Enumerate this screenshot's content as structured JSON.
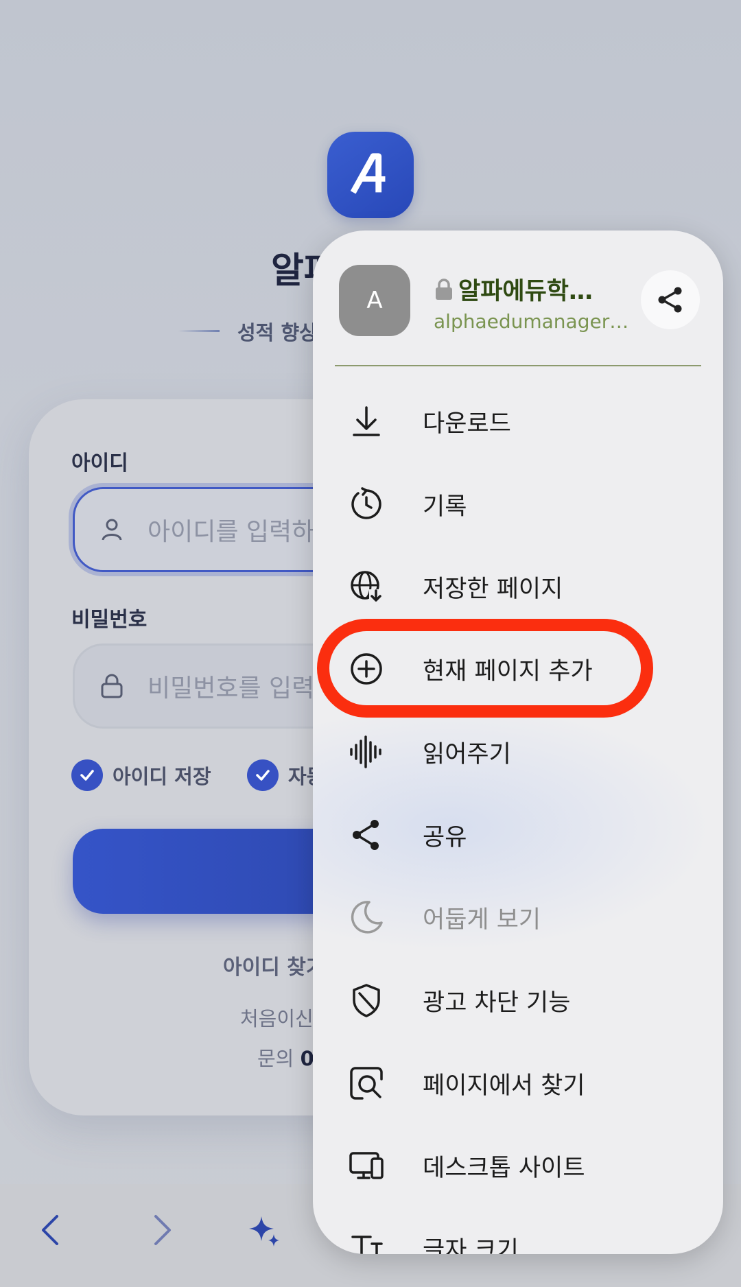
{
  "background_page": {
    "app_title": "알파",
    "tagline": "성적 향상",
    "id_label": "아이디",
    "id_placeholder": "아이디를 입력하",
    "password_label": "비밀번호",
    "password_placeholder": "비밀번호를 입력",
    "remember_id": "아이디 저장",
    "auto_login_partial": "자동",
    "find_id_link": "아이디 찾기",
    "first_time_text": "처음이신",
    "contact_label": "문의",
    "contact_value": "0"
  },
  "popup_menu": {
    "site_avatar_letter": "A",
    "site_title": "알파에듀학…",
    "site_url": "alphaedumanager…",
    "items": [
      {
        "label": "다운로드",
        "icon": "download-icon",
        "enabled": true
      },
      {
        "label": "기록",
        "icon": "history-icon",
        "enabled": true
      },
      {
        "label": "저장한 페이지",
        "icon": "saved-pages-icon",
        "enabled": true
      },
      {
        "label": "현재 페이지 추가",
        "icon": "add-circle-icon",
        "enabled": true,
        "highlighted": true
      },
      {
        "label": "읽어주기",
        "icon": "audio-wave-icon",
        "enabled": true
      },
      {
        "label": "공유",
        "icon": "share-icon",
        "enabled": true
      },
      {
        "label": "어둡게 보기",
        "icon": "moon-icon",
        "enabled": false
      },
      {
        "label": "광고 차단 기능",
        "icon": "ad-block-shield-icon",
        "enabled": true
      },
      {
        "label": "페이지에서 찾기",
        "icon": "find-in-page-icon",
        "enabled": true
      },
      {
        "label": "데스크톱 사이트",
        "icon": "desktop-site-icon",
        "enabled": true
      },
      {
        "label": "글자 크기",
        "icon": "text-size-icon",
        "enabled": true
      }
    ]
  },
  "colors": {
    "accent_blue": "#3751c3",
    "highlight_red": "#fb2e0f",
    "site_title_green": "#2f4a12",
    "site_url_green": "#7a9450"
  }
}
